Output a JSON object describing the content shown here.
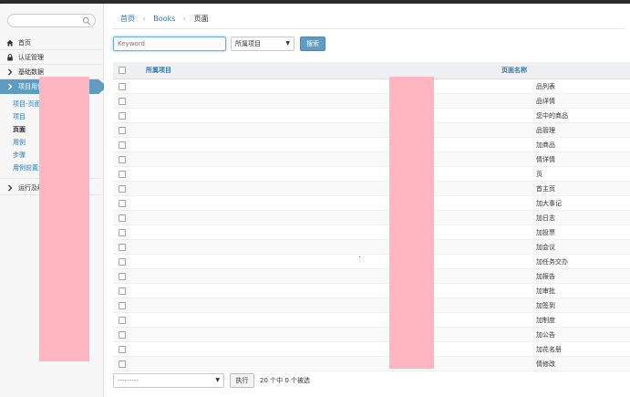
{
  "sidebar": {
    "search_placeholder": "",
    "nav": [
      {
        "label": "首页",
        "icon": "home-icon"
      },
      {
        "label": "认证管理",
        "icon": "lock-icon"
      },
      {
        "label": "基础数据",
        "icon": "chevron-right-icon"
      },
      {
        "label": "项目用例",
        "icon": "chevron-right-icon",
        "active": true
      }
    ],
    "subnav": [
      {
        "label": "项目-页面-用例-步骤"
      },
      {
        "label": "项目"
      },
      {
        "label": "页面",
        "current": true
      },
      {
        "label": "用例"
      },
      {
        "label": "步骤"
      },
      {
        "label": "用例前置步骤"
      }
    ],
    "nav_bottom": {
      "label": "运行及结果",
      "icon": "chevron-right-icon"
    }
  },
  "breadcrumb": {
    "home": "首页",
    "section": "Books",
    "current": "页面"
  },
  "toolbar": {
    "keyword_placeholder": "Keyword",
    "project_select": "所属项目",
    "search_label": "搜索"
  },
  "table": {
    "headers": {
      "project": "所属项目",
      "page_name": "页面名称"
    },
    "rows": [
      "品列表",
      "品详情",
      "您中的商品",
      "品管理",
      "加商品",
      "情详情",
      "页",
      "首主页",
      "加大事记",
      "加日志",
      "加投票",
      "加会议",
      "加任务交办",
      "加报告",
      "加审批",
      "加签到",
      "加制度",
      "加公告",
      "加花名册",
      "情修改"
    ]
  },
  "footer": {
    "action_select": "---------",
    "run_label": "执行",
    "selected_text": "20 个中 0 个被选"
  },
  "colors": {
    "accent": "#5e9cc1",
    "link": "#2a7ab6",
    "redaction": "#ffb6c1"
  }
}
